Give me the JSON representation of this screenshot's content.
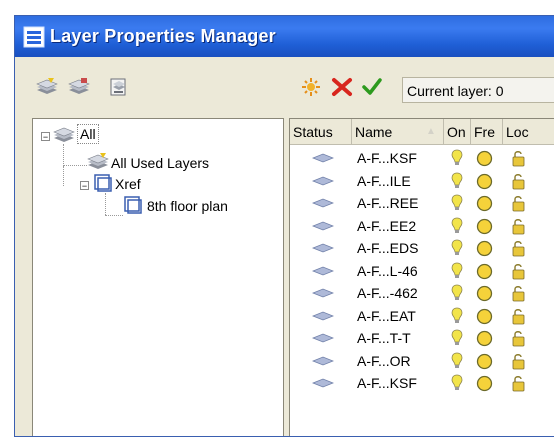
{
  "window": {
    "title": "Layer Properties Manager"
  },
  "toolbar": {
    "buttons_left": [
      "new-property-filter-icon",
      "new-group-filter-icon",
      "layer-states-manager-icon"
    ],
    "buttons_right": [
      "new-layer-icon",
      "delete-layer-icon",
      "set-current-icon"
    ],
    "current_layer_label": "Current layer: 0"
  },
  "tree": {
    "root": "All",
    "children": [
      "All Used Layers",
      "Xref"
    ],
    "xref_children": [
      "8th floor plan"
    ]
  },
  "list": {
    "columns": [
      "Status",
      "Name",
      "On",
      "Fre",
      "Loc"
    ],
    "rows": [
      {
        "name": "A-F...KSF"
      },
      {
        "name": "A-F...ILE"
      },
      {
        "name": "A-F...REE"
      },
      {
        "name": "A-F...EE2"
      },
      {
        "name": "A-F...EDS"
      },
      {
        "name": "A-F...L-46"
      },
      {
        "name": "A-F...-462"
      },
      {
        "name": "A-F...EAT"
      },
      {
        "name": "A-F...T-T"
      },
      {
        "name": "A-F...OR"
      },
      {
        "name": "A-F...KSF"
      }
    ]
  },
  "colors": {
    "titlebar": "#2a66dc",
    "dialog_bg": "#ece9d8",
    "bulb": "#f2e44a",
    "sun": "#f5d23a"
  }
}
